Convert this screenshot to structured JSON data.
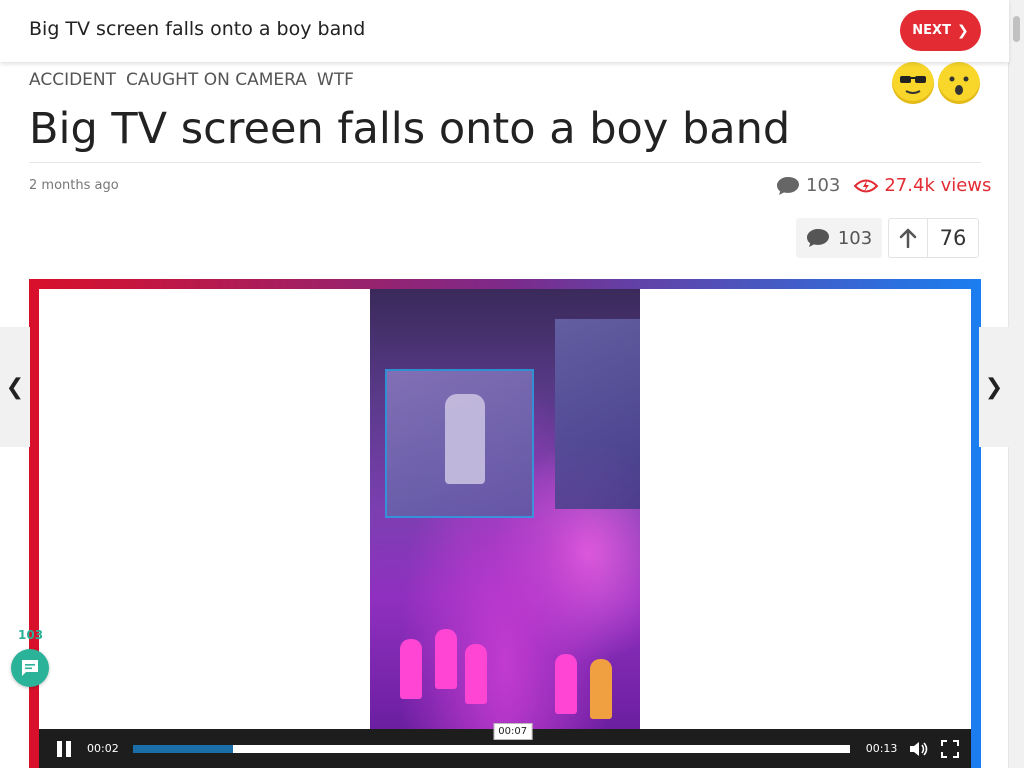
{
  "header": {
    "title": "Big TV screen falls onto a boy band",
    "next_label": "NEXT"
  },
  "categories": [
    "ACCIDENT",
    "CAUGHT ON CAMERA",
    "WTF"
  ],
  "reactions": [
    {
      "icon": "cool-sunglasses-emoji-icon"
    },
    {
      "icon": "surprised-emoji-icon"
    }
  ],
  "article": {
    "title": "Big TV screen falls onto a boy band",
    "time": "2 months ago",
    "comments": "103",
    "views": "27.4k views"
  },
  "actions": {
    "comments": "103",
    "votes": "76"
  },
  "video": {
    "current_time": "00:02",
    "duration": "00:13",
    "hover_time": "00:07",
    "progress": 0.14,
    "hover_position": 0.53
  },
  "floating": {
    "comment_count": "103"
  },
  "colors": {
    "accent": "#e32b34",
    "teal": "#2bb39a",
    "progress": "#1b6fa8"
  }
}
